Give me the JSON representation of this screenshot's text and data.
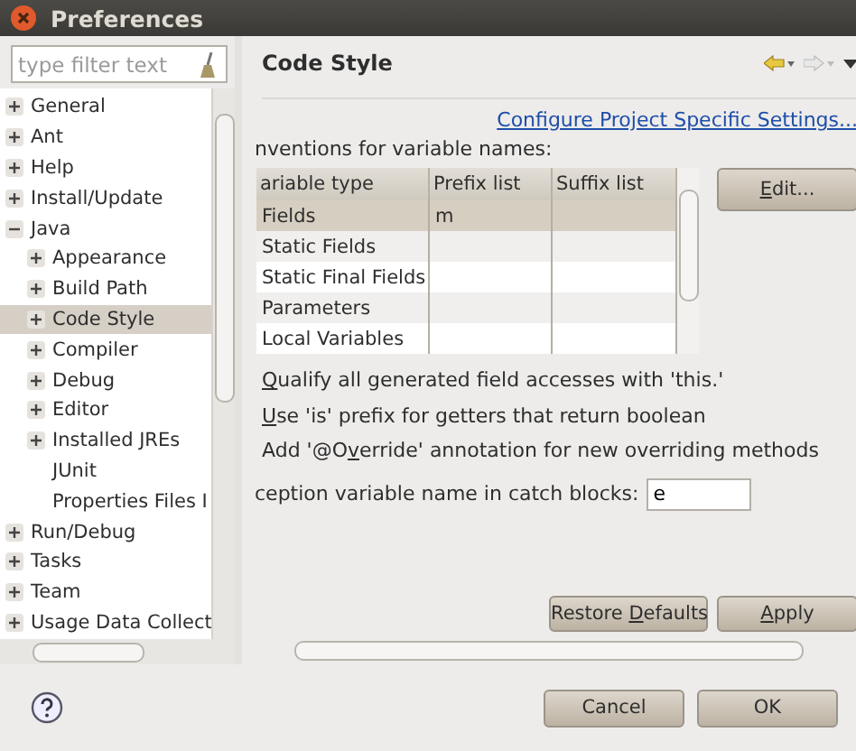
{
  "window": {
    "title": "Preferences"
  },
  "filter": {
    "placeholder": "type filter text"
  },
  "tree": [
    {
      "label": "General",
      "expanded": false,
      "selected": false
    },
    {
      "label": "Ant",
      "expanded": false,
      "selected": false
    },
    {
      "label": "Help",
      "expanded": false,
      "selected": false
    },
    {
      "label": "Install/Update",
      "expanded": false,
      "selected": false
    },
    {
      "label": "Java",
      "expanded": true,
      "selected": false,
      "children": [
        {
          "label": "Appearance",
          "expanded": false,
          "selected": false
        },
        {
          "label": "Build Path",
          "expanded": false,
          "selected": false
        },
        {
          "label": "Code Style",
          "expanded": false,
          "selected": true
        },
        {
          "label": "Compiler",
          "expanded": false,
          "selected": false
        },
        {
          "label": "Debug",
          "expanded": false,
          "selected": false
        },
        {
          "label": "Editor",
          "expanded": false,
          "selected": false
        },
        {
          "label": "Installed JREs",
          "expanded": false,
          "selected": false
        },
        {
          "label": "JUnit",
          "selected": false
        },
        {
          "label": "Properties Files I",
          "selected": false
        }
      ]
    },
    {
      "label": "Run/Debug",
      "expanded": false,
      "selected": false
    },
    {
      "label": "Tasks",
      "expanded": false,
      "selected": false
    },
    {
      "label": "Team",
      "expanded": false,
      "selected": false
    },
    {
      "label": "Usage Data Collect",
      "expanded": false,
      "selected": false
    }
  ],
  "page": {
    "title": "Code Style",
    "link": "Configure Project Specific Settings...",
    "section_label": "nventions for variable names:",
    "table": {
      "columns": [
        "ariable type",
        "Prefix list",
        "Suffix list"
      ],
      "rows": [
        {
          "cells": [
            "Fields",
            "m",
            ""
          ],
          "selected": true
        },
        {
          "cells": [
            "Static Fields",
            "",
            ""
          ],
          "selected": false
        },
        {
          "cells": [
            "Static Final Fields",
            "",
            ""
          ],
          "selected": false
        },
        {
          "cells": [
            "Parameters",
            "",
            ""
          ],
          "selected": false
        },
        {
          "cells": [
            "Local Variables",
            "",
            ""
          ],
          "selected": false
        }
      ]
    },
    "edit_button": {
      "mnemonic": "E",
      "after": "dit..."
    },
    "options": [
      {
        "mnemonic": "Q",
        "after": "ualify all generated field accesses with 'this.'"
      },
      {
        "mnemonic": "U",
        "after": "se 'is' prefix for getters that return boolean"
      },
      {
        "before": "Add '@O",
        "mnemonic": "v",
        "after": "erride' annotation for new overriding methods"
      }
    ],
    "exception_label": "ception variable name in catch blocks:",
    "exception_value": "e",
    "buttons": [
      {
        "before": "Restore ",
        "mnemonic": "D",
        "after": "efaults"
      },
      {
        "mnemonic": "A",
        "after": "pply"
      }
    ]
  },
  "dialog_buttons": [
    "Cancel",
    "OK"
  ]
}
